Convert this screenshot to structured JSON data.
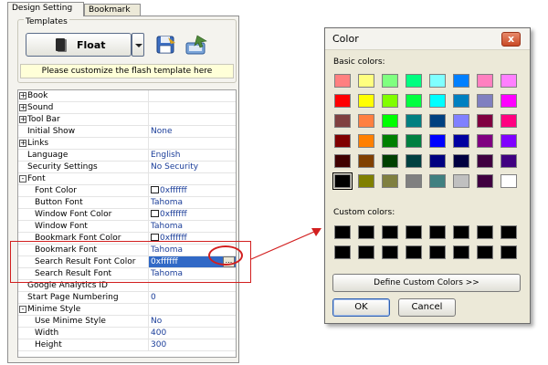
{
  "tabs": [
    {
      "label": "Design Setting",
      "active": true
    },
    {
      "label": "Bookmark",
      "active": false
    }
  ],
  "templates": {
    "title": "Templates",
    "template_name": "Float",
    "hint": "Please customize the flash template here"
  },
  "properties": [
    {
      "name": "Book",
      "value": "",
      "kind": "group",
      "expander": "+"
    },
    {
      "name": "Sound",
      "value": "",
      "kind": "group",
      "expander": "+"
    },
    {
      "name": "Tool Bar",
      "value": "",
      "kind": "group",
      "expander": "+"
    },
    {
      "name": "Initial Show",
      "value": "None",
      "kind": "plain"
    },
    {
      "name": "Links",
      "value": "",
      "kind": "group",
      "expander": "+"
    },
    {
      "name": "Language",
      "value": "English",
      "kind": "plain"
    },
    {
      "name": "Security Settings",
      "value": "No Security",
      "kind": "plain"
    },
    {
      "name": "Font",
      "value": "",
      "kind": "group",
      "expander": "-"
    },
    {
      "name": "Font Color",
      "value": "0xffffff",
      "kind": "child",
      "swatch": "#ffffff"
    },
    {
      "name": "Button Font",
      "value": "Tahoma",
      "kind": "child"
    },
    {
      "name": "Window Font Color",
      "value": "0xffffff",
      "kind": "child",
      "swatch": "#ffffff"
    },
    {
      "name": "Window Font",
      "value": "Tahoma",
      "kind": "child"
    },
    {
      "name": "Bookmark Font Color",
      "value": "0xffffff",
      "kind": "child",
      "swatch": "#ffffff"
    },
    {
      "name": "Bookmark Font",
      "value": "Tahoma",
      "kind": "child"
    },
    {
      "name": "Search Result Font Color",
      "value": "0xffffff",
      "kind": "child",
      "selected": true
    },
    {
      "name": "Search Result Font",
      "value": "Tahoma",
      "kind": "child"
    },
    {
      "name": "Google Analytics ID",
      "value": "",
      "kind": "plain"
    },
    {
      "name": "Start Page Numbering",
      "value": "0",
      "kind": "plain"
    },
    {
      "name": "Minime Style",
      "value": "",
      "kind": "group",
      "expander": "-"
    },
    {
      "name": "Use Minime Style",
      "value": "No",
      "kind": "child"
    },
    {
      "name": "Width",
      "value": "400",
      "kind": "child"
    },
    {
      "name": "Height",
      "value": "300",
      "kind": "child"
    }
  ],
  "ellipsis_label": "...",
  "color_dialog": {
    "title": "Color",
    "close_label": "x",
    "basic_colors_label": "Basic colors:",
    "custom_colors_label": "Custom colors:",
    "define_button": "Define Custom Colors >>",
    "ok_button": "OK",
    "cancel_button": "Cancel",
    "basic_colors": [
      [
        "#ff8080",
        "#ffff80",
        "#80ff80",
        "#00ff80",
        "#80ffff",
        "#0080ff",
        "#ff80c0",
        "#ff80ff"
      ],
      [
        "#ff0000",
        "#ffff00",
        "#80ff00",
        "#00ff40",
        "#00ffff",
        "#0080c0",
        "#8080c0",
        "#ff00ff"
      ],
      [
        "#804040",
        "#ff8040",
        "#00ff00",
        "#008080",
        "#004080",
        "#8080ff",
        "#800040",
        "#ff0080"
      ],
      [
        "#800000",
        "#ff8000",
        "#008000",
        "#008040",
        "#0000ff",
        "#0000a0",
        "#800080",
        "#8000ff"
      ],
      [
        "#400000",
        "#804000",
        "#004000",
        "#004040",
        "#000080",
        "#000040",
        "#400040",
        "#400080"
      ],
      [
        "#000000",
        "#808000",
        "#808040",
        "#808080",
        "#408080",
        "#c0c0c0",
        "#400040",
        "#ffffff"
      ]
    ],
    "selected_basic": [
      5,
      0
    ],
    "custom_colors": [
      [
        "#000000",
        "#000000",
        "#000000",
        "#000000",
        "#000000",
        "#000000",
        "#000000",
        "#000000"
      ],
      [
        "#000000",
        "#000000",
        "#000000",
        "#000000",
        "#000000",
        "#000000",
        "#000000",
        "#000000"
      ]
    ]
  },
  "colors": {
    "highlight": "#d21f1f",
    "value_text": "#1a3d99",
    "selection": "#3169c6"
  }
}
